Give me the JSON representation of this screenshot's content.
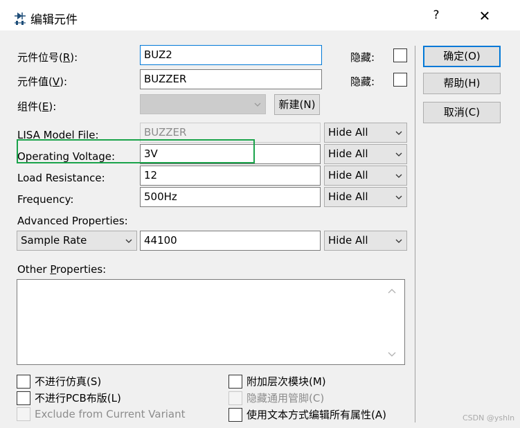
{
  "window": {
    "title": "编辑元件",
    "help_label": "?",
    "close_label": "✕",
    "title_icon": "component-edit-icon"
  },
  "fields": {
    "ref_label_prefix": "元件位号(",
    "ref_label_key": "R",
    "ref_label_suffix": "):",
    "ref_value": "BUZ2",
    "ref_hidden_label": "隐藏:",
    "val_label_prefix": "元件值(",
    "val_label_key": "V",
    "val_label_suffix": "):",
    "val_value": "BUZZER",
    "val_hidden_label": "隐藏:",
    "grp_label_prefix": "组件(",
    "grp_label_key": "E",
    "grp_label_suffix": "):",
    "grp_value": "",
    "new_button": "新建(N)"
  },
  "properties": [
    {
      "label": "LISA Model File:",
      "value": "BUZZER",
      "visibility": "Hide All"
    },
    {
      "label": "Operating Voltage:",
      "value": "3V",
      "visibility": "Hide All"
    },
    {
      "label": "Load Resistance:",
      "value": "12",
      "visibility": "Hide All"
    },
    {
      "label": "Frequency:",
      "value": "500Hz",
      "visibility": "Hide All"
    }
  ],
  "advanced": {
    "label": "Advanced Properties:",
    "selected": "Sample Rate",
    "value": "44100",
    "visibility": "Hide All"
  },
  "other": {
    "label_prefix": "Other ",
    "label_key": "P",
    "label_suffix": "roperties:",
    "value": ""
  },
  "options": {
    "exclude_sim": "不进行仿真(S)",
    "exclude_pcb": "不进行PCB布版(L)",
    "exclude_variant": "Exclude from Current Variant",
    "attach_hierarchy": "附加层次模块(M)",
    "hide_common_pins": "隐藏通用管脚(C)",
    "edit_as_text": "使用文本方式编辑所有属性(A)"
  },
  "buttons": {
    "ok": "确定(O)",
    "help": "帮助(H)",
    "cancel": "取消(C)"
  },
  "watermark": "CSDN @yshln",
  "colors": {
    "highlight": "#19a34a",
    "focus": "#0078d7"
  }
}
